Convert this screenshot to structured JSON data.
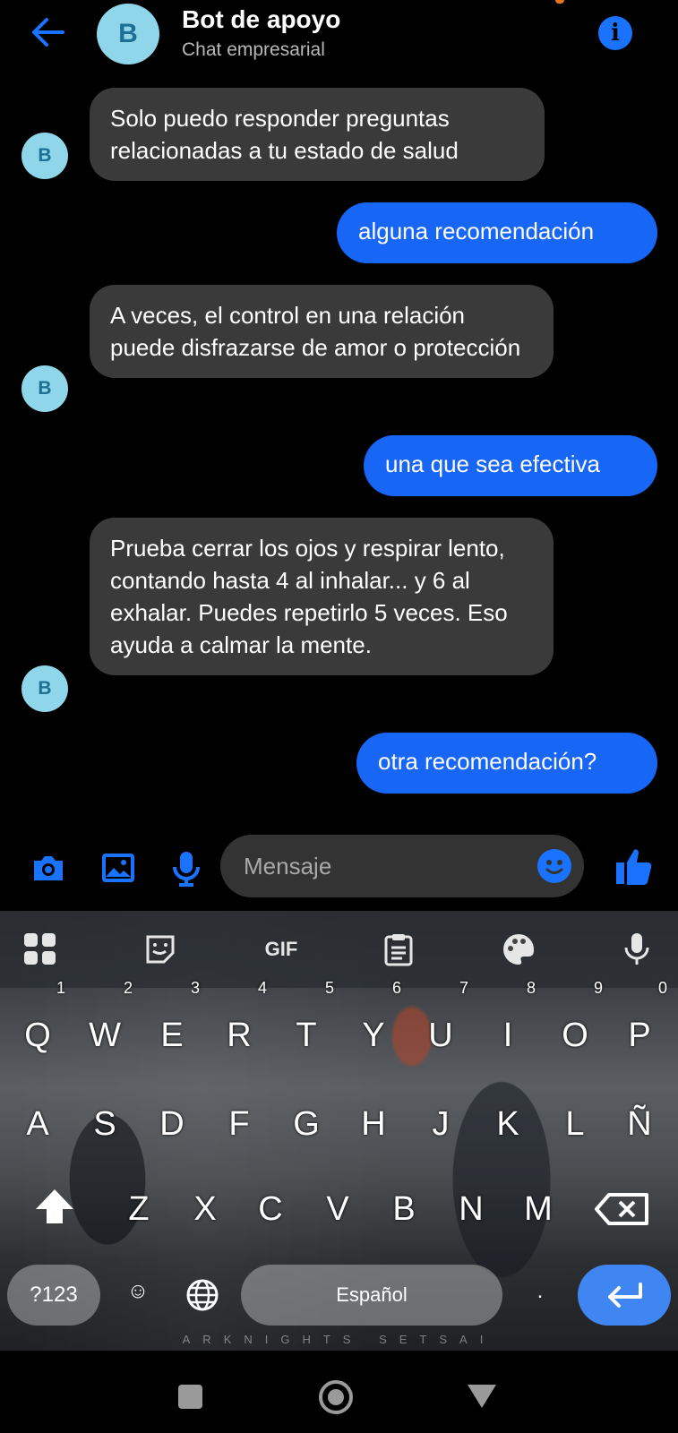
{
  "header": {
    "avatar_letter": "B",
    "title": "Bot de apoyo",
    "subtitle": "Chat empresarial",
    "info_glyph": "i",
    "back_icon": "arrow-left-icon",
    "accent": "#1a73ff"
  },
  "messages": [
    {
      "from": "bot",
      "text": "Solo puedo responder preguntas relacionadas a tu estado de salud",
      "avatar": "B"
    },
    {
      "from": "user",
      "text": "alguna recomendación"
    },
    {
      "from": "bot",
      "text": "A veces, el control en una relación puede disfrazarse de amor o protección",
      "avatar": "B"
    },
    {
      "from": "user",
      "text": "una que sea efectiva"
    },
    {
      "from": "bot",
      "text": "Prueba cerrar los ojos y respirar lento, contando hasta 4 al inhalar... y 6 al exhalar. Puedes repetirlo 5 veces. Eso ayuda a calmar la mente.",
      "avatar": "B"
    },
    {
      "from": "user",
      "text": "otra recomendación?"
    }
  ],
  "composer": {
    "placeholder": "Mensaje",
    "icons": [
      "camera-icon",
      "image-icon",
      "microphone-icon",
      "emoji-icon",
      "thumbs-up-icon"
    ]
  },
  "keyboard": {
    "toolbar": [
      "apps-grid-icon",
      "sticker-icon",
      "gif-icon",
      "clipboard-icon",
      "palette-icon",
      "microphone-icon"
    ],
    "gif_label": "GIF",
    "row1": [
      {
        "k": "Q",
        "n": "1"
      },
      {
        "k": "W",
        "n": "2"
      },
      {
        "k": "E",
        "n": "3"
      },
      {
        "k": "R",
        "n": "4"
      },
      {
        "k": "T",
        "n": "5"
      },
      {
        "k": "Y",
        "n": "6"
      },
      {
        "k": "U",
        "n": "7"
      },
      {
        "k": "I",
        "n": "8"
      },
      {
        "k": "O",
        "n": "9"
      },
      {
        "k": "P",
        "n": "0"
      }
    ],
    "row2": [
      "A",
      "S",
      "D",
      "F",
      "G",
      "H",
      "J",
      "K",
      "L",
      "Ñ"
    ],
    "row3": [
      "Z",
      "X",
      "C",
      "V",
      "B",
      "N",
      "M"
    ],
    "sym_label": "?123",
    "emoji_comma": "☺",
    "space_label": "Español",
    "period": ".",
    "watermark": "ARKNIGHTS SETSAI"
  },
  "navbar": [
    "recents-icon",
    "home-icon",
    "back-icon"
  ]
}
